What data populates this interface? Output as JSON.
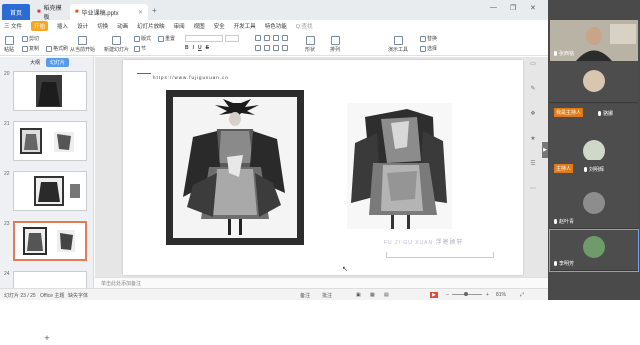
{
  "titlebar": {
    "home_tab": "首页",
    "doc_tab_1": "稻壳模板",
    "doc_tab_2": "毕业课稿.pptx",
    "new_tab": "+",
    "win_min": "—",
    "win_max": "❐",
    "win_close": "✕"
  },
  "menubar": {
    "file": "三 文件",
    "items": [
      "开始",
      "插入",
      "设计",
      "切换",
      "动画",
      "幻灯片放映",
      "审阅",
      "视图",
      "安全",
      "开发工具",
      "特色功能"
    ],
    "active": "开始",
    "search": "Q 查找"
  },
  "ribbon": {
    "items": [
      "粘贴",
      "剪切",
      "复制",
      "格式刷",
      "从当前开始",
      "新建幻灯片",
      "版式",
      "节",
      "重置",
      "形状",
      "排列",
      "演示工具",
      "替换",
      "选择"
    ]
  },
  "sidebar": {
    "tabs": [
      "大纲",
      "幻灯片"
    ],
    "selected_tab": "幻灯片",
    "slide_numbers": [
      "20",
      "21",
      "22",
      "23",
      "24"
    ],
    "selected_slide": "23",
    "add_button": "+"
  },
  "slide": {
    "url": "https://www.fujiguxuan.cn",
    "watermark_text": "FU JI GU XUAN",
    "watermark_cn": "浮寄顾轩"
  },
  "notes": {
    "placeholder": "单击此处添加备注"
  },
  "statusbar": {
    "slide_indicator": "幻灯片 23 / 25",
    "theme": "Office 主题",
    "missing_font": "缺失字体",
    "notes_btn": "备注",
    "comments_btn": "批注",
    "zoom": "81%"
  },
  "meeting": {
    "participants": [
      {
        "name": "张西铭",
        "host": ""
      },
      {
        "name": "",
        "host": ""
      },
      {
        "name": "骆娜",
        "host": "我是主持人"
      },
      {
        "name": "",
        "host": ""
      },
      {
        "name": "刘明辉",
        "host": "主持人"
      },
      {
        "name": "赵叶青",
        "host": ""
      },
      {
        "name": "李明芳",
        "host": ""
      }
    ]
  }
}
